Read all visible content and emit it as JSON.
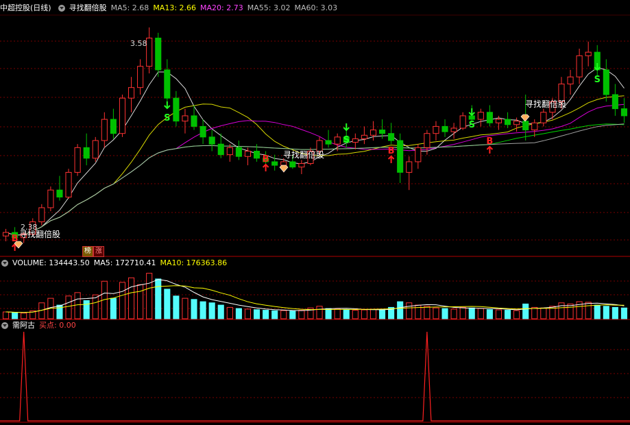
{
  "header": {
    "stock_name": "中超控股",
    "period": "(日线)",
    "indicator_name": "寻找翻倍股",
    "ma5": "MA5: 2.68",
    "ma13": "MA13: 2.66",
    "ma20": "MA20: 2.73",
    "ma55": "MA55: 3.02",
    "ma60": "MA60: 3.03"
  },
  "volume_header": {
    "label": "VOLUME: 134443.50",
    "ma5": "MA5: 172710.41",
    "ma10": "MA10: 176363.86"
  },
  "indicator_header": {
    "name": "需阿古",
    "buy_label": "买点: 0.00"
  },
  "flags": {
    "bang": "榜",
    "zhang": "涨"
  },
  "annotations": {
    "high_price": "3.58",
    "low_price": "2.38",
    "signal_text_1": "寻找翻倍股",
    "signal_text_2": "寻找翻倍股",
    "signal_text_3": "寻找翻倍股",
    "buy_mark": "B",
    "sell_mark": "S"
  },
  "colors": {
    "up": "#ff3232",
    "down": "#54fcfc",
    "down_candle": "#00c000",
    "ma5": "#ffffff",
    "ma13": "#ffff00",
    "ma20": "#ff00ff",
    "ma55": "#00ff00",
    "ma60": "#c0c0c0",
    "grid": "#7a0000"
  },
  "chart_data": {
    "type": "candlestick",
    "price_range": [
      2.3,
      3.65
    ],
    "candles": [
      [
        2.4,
        2.44,
        2.37,
        2.42
      ],
      [
        2.42,
        2.45,
        2.38,
        2.39
      ],
      [
        2.39,
        2.42,
        2.36,
        2.41
      ],
      [
        2.41,
        2.5,
        2.4,
        2.48
      ],
      [
        2.48,
        2.58,
        2.46,
        2.56
      ],
      [
        2.56,
        2.68,
        2.54,
        2.66
      ],
      [
        2.66,
        2.74,
        2.6,
        2.62
      ],
      [
        2.62,
        2.78,
        2.61,
        2.76
      ],
      [
        2.76,
        2.92,
        2.74,
        2.9
      ],
      [
        2.9,
        2.98,
        2.8,
        2.84
      ],
      [
        2.84,
        2.96,
        2.82,
        2.94
      ],
      [
        2.94,
        3.1,
        2.9,
        3.06
      ],
      [
        3.06,
        3.12,
        2.95,
        2.98
      ],
      [
        2.98,
        3.2,
        2.96,
        3.18
      ],
      [
        3.18,
        3.3,
        3.1,
        3.24
      ],
      [
        3.24,
        3.4,
        3.2,
        3.36
      ],
      [
        3.36,
        3.58,
        3.32,
        3.52
      ],
      [
        3.52,
        3.55,
        3.3,
        3.34
      ],
      [
        3.34,
        3.4,
        3.15,
        3.18
      ],
      [
        3.18,
        3.22,
        3.02,
        3.05
      ],
      [
        3.05,
        3.12,
        2.98,
        3.08
      ],
      [
        3.08,
        3.14,
        3.0,
        3.02
      ],
      [
        3.02,
        3.06,
        2.92,
        2.96
      ],
      [
        2.96,
        3.0,
        2.88,
        2.92
      ],
      [
        2.92,
        2.98,
        2.84,
        2.86
      ],
      [
        2.86,
        2.92,
        2.82,
        2.9
      ],
      [
        2.9,
        2.94,
        2.83,
        2.85
      ],
      [
        2.85,
        2.9,
        2.8,
        2.88
      ],
      [
        2.88,
        2.92,
        2.82,
        2.84
      ],
      [
        2.84,
        2.88,
        2.78,
        2.82
      ],
      [
        2.82,
        2.86,
        2.77,
        2.8
      ],
      [
        2.8,
        2.84,
        2.76,
        2.82
      ],
      [
        2.82,
        2.86,
        2.78,
        2.79
      ],
      [
        2.79,
        2.83,
        2.75,
        2.81
      ],
      [
        2.81,
        2.9,
        2.8,
        2.88
      ],
      [
        2.88,
        2.96,
        2.86,
        2.94
      ],
      [
        2.94,
        3.0,
        2.9,
        2.92
      ],
      [
        2.92,
        2.98,
        2.88,
        2.96
      ],
      [
        2.96,
        3.0,
        2.9,
        2.93
      ],
      [
        2.93,
        2.98,
        2.89,
        2.95
      ],
      [
        2.95,
        3.02,
        2.92,
        2.97
      ],
      [
        2.97,
        3.05,
        2.94,
        3.0
      ],
      [
        3.0,
        3.06,
        2.95,
        2.98
      ],
      [
        2.98,
        3.04,
        2.92,
        2.94
      ],
      [
        2.94,
        2.98,
        2.7,
        2.76
      ],
      [
        2.76,
        2.85,
        2.66,
        2.82
      ],
      [
        2.82,
        2.92,
        2.78,
        2.9
      ],
      [
        2.9,
        3.0,
        2.86,
        2.98
      ],
      [
        2.98,
        3.05,
        2.94,
        3.02
      ],
      [
        3.02,
        3.06,
        2.96,
        2.99
      ],
      [
        2.99,
        3.04,
        2.95,
        3.01
      ],
      [
        3.01,
        3.1,
        3.0,
        3.08
      ],
      [
        3.08,
        3.14,
        3.04,
        3.06
      ],
      [
        3.06,
        3.12,
        3.02,
        3.1
      ],
      [
        3.1,
        3.14,
        3.02,
        3.04
      ],
      [
        3.04,
        3.08,
        3.0,
        3.06
      ],
      [
        3.06,
        3.1,
        3.01,
        3.03
      ],
      [
        3.03,
        3.07,
        2.99,
        3.05
      ],
      [
        3.05,
        3.2,
        2.94,
        3.0
      ],
      [
        3.0,
        3.06,
        2.96,
        3.04
      ],
      [
        3.04,
        3.12,
        3.02,
        3.1
      ],
      [
        3.1,
        3.18,
        3.06,
        3.16
      ],
      [
        3.16,
        3.3,
        3.12,
        3.26
      ],
      [
        3.26,
        3.34,
        3.2,
        3.3
      ],
      [
        3.3,
        3.46,
        3.26,
        3.42
      ],
      [
        3.42,
        3.5,
        3.36,
        3.44
      ],
      [
        3.44,
        3.48,
        3.3,
        3.34
      ],
      [
        3.34,
        3.4,
        3.16,
        3.2
      ],
      [
        3.2,
        3.26,
        3.08,
        3.12
      ],
      [
        3.12,
        3.18,
        3.04,
        3.08
      ]
    ],
    "volume_range": [
      0,
      440000
    ],
    "volume": [
      60,
      55,
      50,
      70,
      140,
      180,
      120,
      200,
      230,
      160,
      210,
      330,
      180,
      320,
      360,
      300,
      400,
      350,
      260,
      200,
      180,
      170,
      150,
      140,
      120,
      100,
      90,
      85,
      80,
      75,
      70,
      72,
      68,
      75,
      95,
      110,
      90,
      85,
      80,
      75,
      78,
      82,
      80,
      100,
      150,
      140,
      120,
      110,
      95,
      90,
      85,
      100,
      95,
      90,
      80,
      78,
      75,
      72,
      130,
      100,
      95,
      110,
      140,
      130,
      150,
      145,
      120,
      110,
      100,
      95
    ],
    "buy_signals_x": [
      2,
      47,
      96
    ],
    "indicator_range": [
      0,
      1
    ]
  }
}
